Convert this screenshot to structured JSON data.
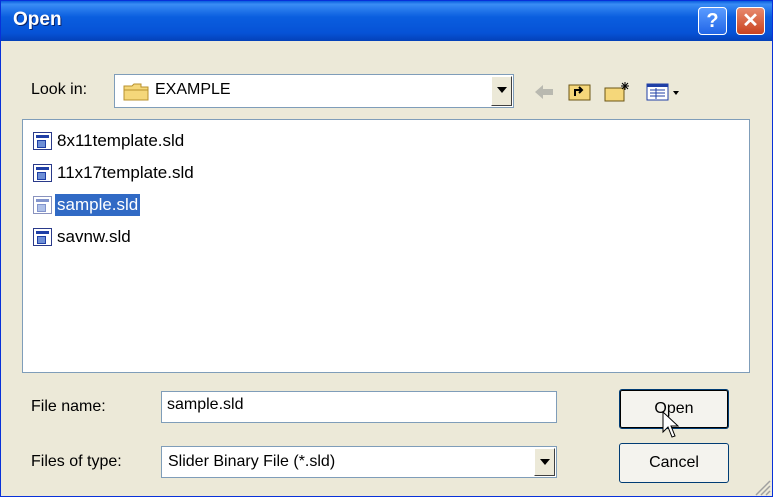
{
  "dialog": {
    "title": "Open",
    "help_glyph": "?",
    "close_glyph": "✕"
  },
  "look_in": {
    "label": "Look in:",
    "value": "EXAMPLE"
  },
  "toolbar": {
    "icons": [
      "back-arrow-icon",
      "up-folder-icon",
      "new-folder-icon",
      "view-menu-icon"
    ]
  },
  "files": [
    {
      "name": "8x11template.sld",
      "selected": false
    },
    {
      "name": "11x17template.sld",
      "selected": false
    },
    {
      "name": "sample.sld",
      "selected": true
    },
    {
      "name": "savnw.sld",
      "selected": false
    }
  ],
  "file_name": {
    "label": "File name:",
    "value": "sample.sld"
  },
  "file_type": {
    "label": "Files of type:",
    "value": "Slider Binary File (*.sld)"
  },
  "buttons": {
    "open": "Open",
    "cancel": "Cancel"
  },
  "colors": {
    "selection": "#316AC5",
    "titlebar": "#0A5EDF",
    "dialog_bg": "#ECE9D8"
  }
}
